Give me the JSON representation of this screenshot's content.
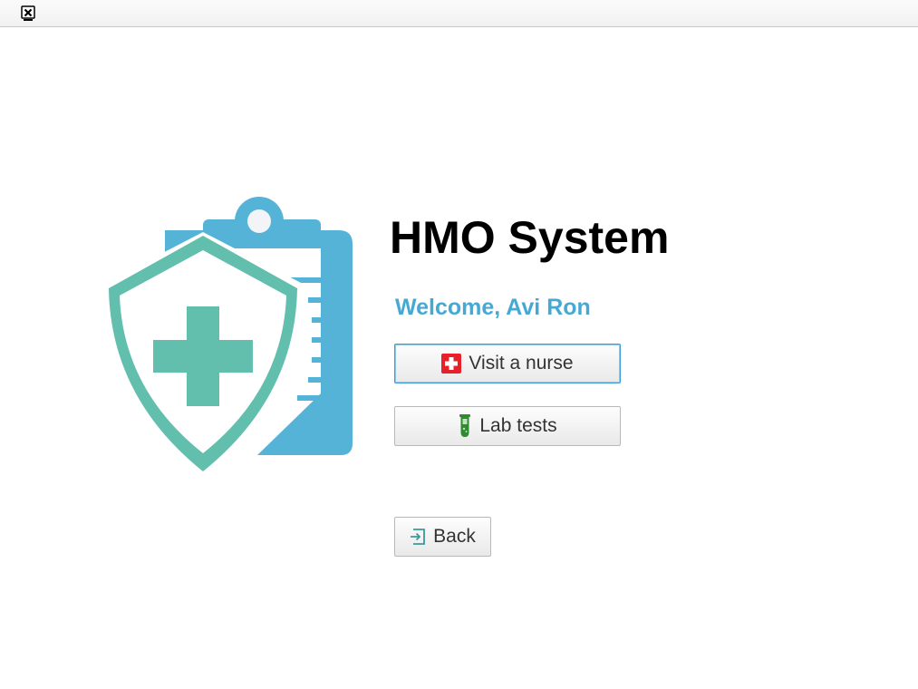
{
  "window": {
    "icon": "window-close-icon"
  },
  "logo": {
    "icon": "medical-shield-clipboard-icon",
    "colors": {
      "clipboard": "#56b3d8",
      "shield": "#62bead"
    }
  },
  "main": {
    "title": "HMO System",
    "welcome": "Welcome, Avi Ron",
    "welcome_color": "#45a9d4"
  },
  "buttons": {
    "visit_nurse": {
      "label": "Visit a nurse",
      "icon": "red-cross-icon",
      "icon_color": "#e8202a"
    },
    "lab_tests": {
      "label": "Lab tests",
      "icon": "test-tube-icon",
      "icon_color": "#2e8b2e"
    },
    "back": {
      "label": "Back",
      "icon": "exit-icon",
      "icon_color": "#3a9a9a"
    }
  }
}
